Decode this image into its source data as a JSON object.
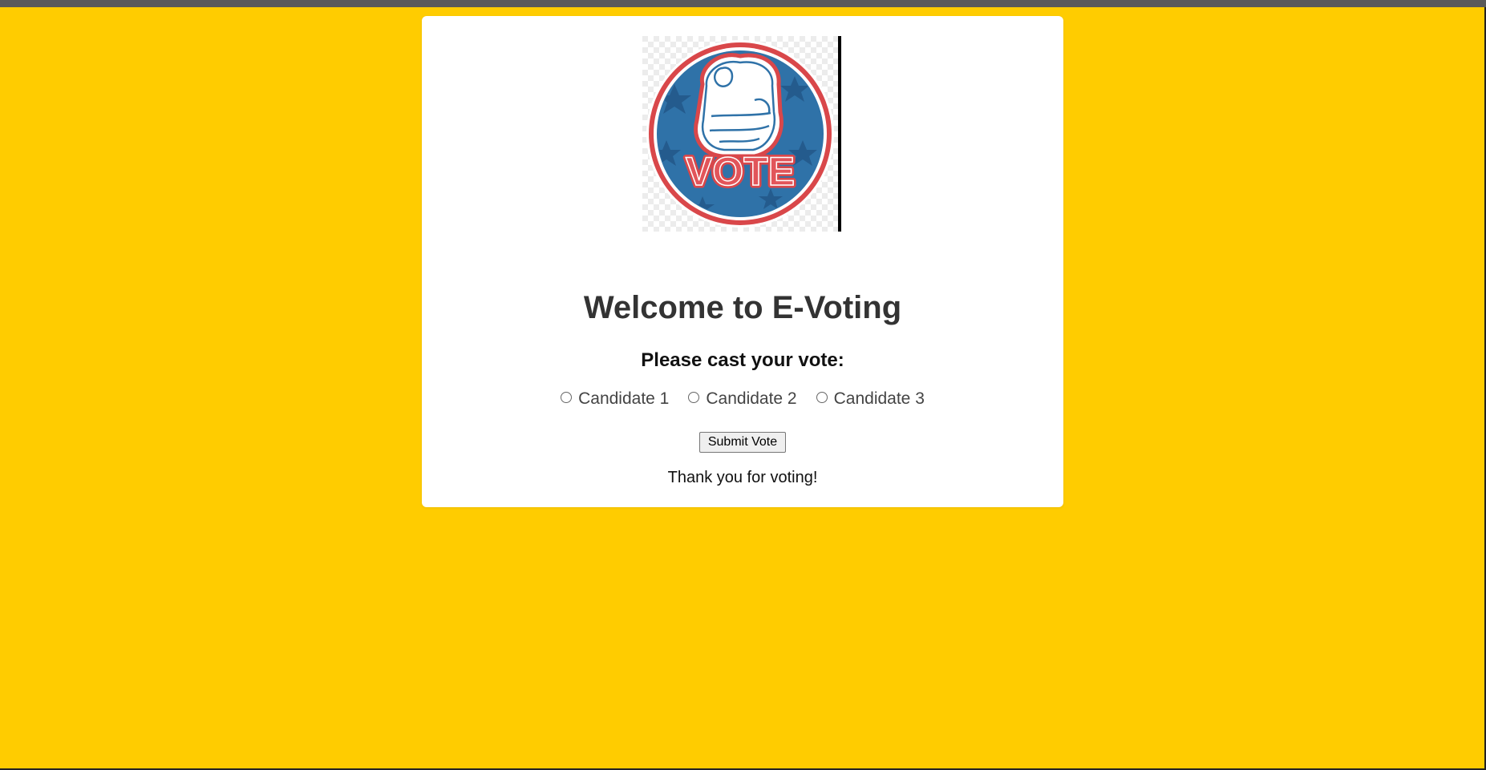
{
  "logo": {
    "alt": "Vote badge with pointing hand",
    "badge_text": "VOTE"
  },
  "title": "Welcome to E-Voting",
  "prompt": "Please cast your vote:",
  "candidates": [
    {
      "label": "Candidate 1",
      "selected": false
    },
    {
      "label": "Candidate 2",
      "selected": false
    },
    {
      "label": "Candidate 3",
      "selected": false
    }
  ],
  "submit_label": "Submit Vote",
  "status_message": "Thank you for voting!",
  "colors": {
    "background": "#ffcc00",
    "card": "#ffffff",
    "badge_blue": "#2f72a8",
    "badge_red": "#d9474a"
  }
}
